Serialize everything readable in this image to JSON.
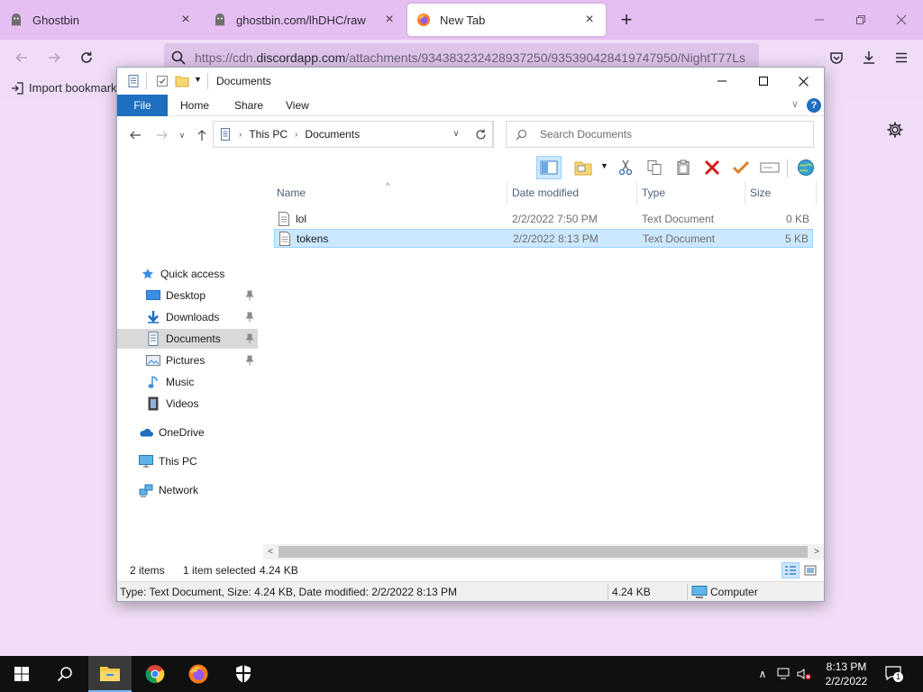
{
  "firefox": {
    "tabs": [
      {
        "label": "Ghostbin",
        "icon": "ghost-icon",
        "active": false
      },
      {
        "label": "ghostbin.com/lhDHC/raw",
        "icon": "ghost-icon",
        "active": false
      },
      {
        "label": "New Tab",
        "icon": "firefox-icon",
        "active": true
      }
    ],
    "url_prefix": "https://cdn.",
    "url_domain": "discordapp.com",
    "url_path": "/attachments/934383232428937250/935390428419747950/NightT77Ls",
    "bookmarks_import_label": "Import bookmarks..."
  },
  "explorer": {
    "title": "Documents",
    "ribbon_tabs": [
      "File",
      "Home",
      "Share",
      "View"
    ],
    "help_label": "?",
    "breadcrumbs": [
      "This PC",
      "Documents"
    ],
    "search_placeholder": "Search Documents",
    "nav_items": [
      {
        "label": "Quick access",
        "icon": "star-icon",
        "pinned": false,
        "selected": false
      },
      {
        "label": "Desktop",
        "icon": "desktop-icon",
        "pinned": true,
        "selected": false
      },
      {
        "label": "Downloads",
        "icon": "download-icon",
        "pinned": true,
        "selected": false
      },
      {
        "label": "Documents",
        "icon": "documents-icon",
        "pinned": true,
        "selected": true
      },
      {
        "label": "Pictures",
        "icon": "pictures-icon",
        "pinned": true,
        "selected": false
      },
      {
        "label": "Music",
        "icon": "music-icon",
        "pinned": false,
        "selected": false
      },
      {
        "label": "Videos",
        "icon": "videos-icon",
        "pinned": false,
        "selected": false
      },
      {
        "label": "OneDrive",
        "icon": "cloud-icon",
        "pinned": false,
        "selected": false
      },
      {
        "label": "This PC",
        "icon": "computer-icon",
        "pinned": false,
        "selected": false
      },
      {
        "label": "Network",
        "icon": "network-icon",
        "pinned": false,
        "selected": false
      }
    ],
    "columns": [
      "Name",
      "Date modified",
      "Type",
      "Size"
    ],
    "files": [
      {
        "name": "lol",
        "date": "2/2/2022 7:50 PM",
        "type": "Text Document",
        "size": "0 KB",
        "selected": false
      },
      {
        "name": "tokens",
        "date": "2/2/2022 8:13 PM",
        "type": "Text Document",
        "size": "5 KB",
        "selected": true
      }
    ],
    "status": {
      "item_count": "2 items",
      "selected_count": "1 item selected",
      "selected_size": "4.24 KB",
      "details": "Type: Text Document, Size: 4.24 KB, Date modified: 2/2/2022 8:13 PM",
      "details_size": "4.24 KB",
      "location": "Computer"
    }
  },
  "taskbar": {
    "time": "8:13 PM",
    "date": "2/2/2022",
    "notification_count": "1"
  },
  "colors": {
    "firefox_tabbar": "#e6bff2",
    "firefox_toolbar": "#f0dcf7",
    "explorer_accent": "#1e6fbf",
    "selection": "#cce8ff",
    "taskbar": "#101010"
  }
}
